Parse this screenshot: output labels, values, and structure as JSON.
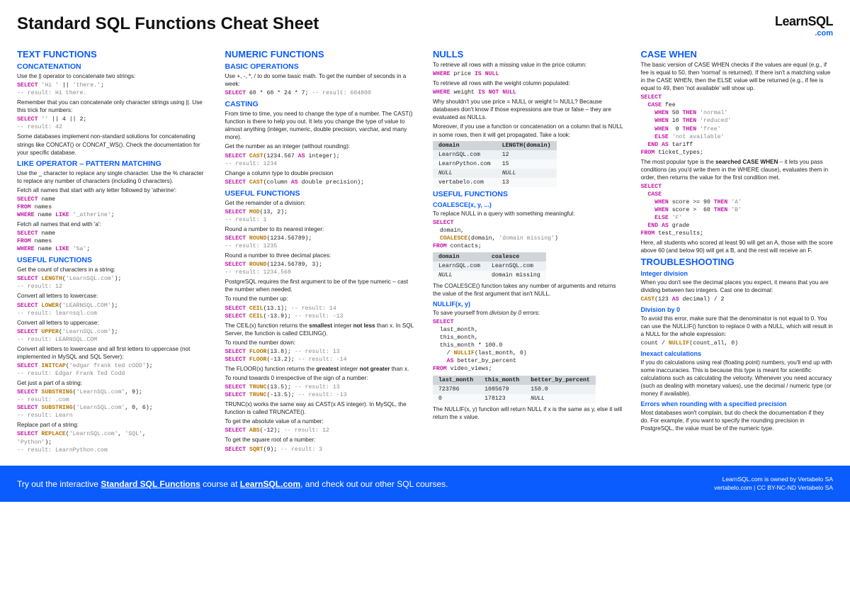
{
  "header": {
    "title": "Standard SQL Functions Cheat Sheet",
    "logo_top": "LearnSQL",
    "logo_bot": ".com"
  },
  "col1": {
    "h2": "TEXT FUNCTIONS",
    "s1": {
      "h3": "CONCATENATION",
      "p1": "Use the || operator to concatenate two strings:",
      "c1": "SELECT 'Hi ' || 'there.';\n-- result: Hi there.",
      "p2": "Remember that you can concatenate only character strings using ||. Use this trick for numbers:",
      "c2": "SELECT '' || 4 || 2;\n-- result: 42",
      "p3": "Some databases implement non-standard solutions for concatenating strings like CONCAT() or CONCAT_WS(). Check the documentation for your specific database."
    },
    "s2": {
      "h3": "LIKE OPERATOR – PATTERN MATCHING",
      "p1": "Use the _ character to replace any single character. Use the % character to replace any number of characters (including 0 characters).",
      "p2": "Fetch all names that start with any letter followed by 'atherine':",
      "c1": "SELECT name\nFROM names\nWHERE name LIKE '_atherine';",
      "p3": "Fetch all names that end with 'a':",
      "c2": "SELECT name\nFROM names\nWHERE name LIKE '%a';"
    },
    "s3": {
      "h3": "USEFUL FUNCTIONS",
      "p1": "Get the count of characters in a string:",
      "c1": "SELECT LENGTH('LearnSQL.com');\n-- result: 12",
      "p2": "Convert all letters to lowercase:",
      "c2": "SELECT LOWER('LEARNSQL.COM');\n-- result: learnsql.com",
      "p3": "Convert all letters to uppercase:",
      "c3": "SELECT UPPER('LearnSQL.com');\n-- result: LEARNSQL.COM",
      "p4": "Convert all letters to lowercase and all first letters to uppercase (not implemented in MySQL and SQL Server):",
      "c4": "SELECT INITCAP('edgar frank ted cODD');\n-- result: Edgar Frank Ted Codd",
      "p5": "Get just a part of a string:",
      "c5": "SELECT SUBSTRING('LearnSQL.com', 9);\n-- result: .com\nSELECT SUBSTRING('LearnSQL.com', 0, 6);\n-- result: Learn",
      "p6": "Replace part of a string:",
      "c6": "SELECT REPLACE('LearnSQL.com', 'SQL', 'Python');\n-- result: LearnPython.com"
    }
  },
  "col2": {
    "h2": "NUMERIC FUNCTIONS",
    "s1": {
      "h3": "BASIC OPERATIONS",
      "p1": "Use +, -, *, / to do some basic math. To get the number of seconds in a week:",
      "c1": "SELECT 60 * 60 * 24 * 7; -- result: 604800"
    },
    "s2": {
      "h3": "CASTING",
      "p1": "From time to time, you need to change the type of a number. The CAST() function is there to help you out. It lets you change the type of value to almost anything (integer, numeric, double precision, varchar, and many more).",
      "p2": "Get the number as an integer (without rounding):",
      "c1": "SELECT CAST(1234.567 AS integer);\n-- result: 1234",
      "p3": "Change a column type to double precision",
      "c2": "SELECT CAST(column AS double precision);"
    },
    "s3": {
      "h3": "USEFUL FUNCTIONS",
      "p1": "Get the remainder of a division:",
      "c1": "SELECT MOD(13, 2);\n-- result: 1",
      "p2": "Round a number to its nearest integer:",
      "c2": "SELECT ROUND(1234.56789);\n-- result: 1235",
      "p3": "Round a number to three decimal places:",
      "c3": "SELECT ROUND(1234.56789, 3);\n-- result: 1234.568",
      "p4": "PostgreSQL requires the first argument to be of the type numeric – cast the number when needed.",
      "p5": "To round the number up:",
      "c4": "SELECT CEIL(13.1); -- result: 14\nSELECT CEIL(-13.9); -- result: -13",
      "p6_a": "The CEIL(x) function returns the ",
      "p6_b": "smallest",
      "p6_c": " integer ",
      "p6_d": "not less",
      "p6_e": " than x. In SQL Server, the function is called CEILING().",
      "p7": "To round the number down:",
      "c5": "SELECT FLOOR(13.8); -- result: 13\nSELECT FLOOR(-13.2); -- result: -14",
      "p8_a": "The FLOOR(x) function returns the ",
      "p8_b": "greatest",
      "p8_c": " integer ",
      "p8_d": "not greater",
      "p8_e": " than x.",
      "p9": "To round towards 0 irrespective of the sign of a number:",
      "c6": "SELECT TRUNC(13.5); -- result: 13\nSELECT TRUNC(-13.5); -- result: -13",
      "p10": "TRUNC(x) works the same way as CAST(x AS integer). In MySQL, the function is called TRUNCATE().",
      "p11": "To get the absolute value of a number:",
      "c7": "SELECT ABS(-12); -- result: 12",
      "p12": "To get the square root of a number:",
      "c8": "SELECT SQRT(9); -- result: 3"
    }
  },
  "col3": {
    "h2": "NULLs",
    "s1": {
      "p1": "To retrieve all rows with a missing value in the price column:",
      "c1": "WHERE price IS NULL",
      "p2": "To retrieve all rows with the weight column populated:",
      "c2": "WHERE weight IS NOT NULL",
      "p3": "Why shouldn't you use price = NULL or weight != NULL? Because databases don't know if those expressions are true or false – they are evaluated as NULLs.",
      "p4": "Moreover, if you use a function or concatenation on a column that is NULL in some rows, then it will get propagated. Take a look:",
      "table": {
        "headers": [
          "domain",
          "LENGTH(domain)"
        ],
        "rows": [
          [
            "LearnSQL.com",
            "12"
          ],
          [
            "LearnPython.com",
            "15"
          ],
          [
            "NULL",
            "NULL"
          ],
          [
            "vertabelo.com",
            "13"
          ]
        ]
      }
    },
    "s2": {
      "h3": "USEFUL FUNCTIONS",
      "h4a": "COALESCE(x, y, ...)",
      "p1": "To replace NULL in a query with something meaningful:",
      "c1": "SELECT\n  domain,\n  COALESCE(domain, 'domain missing')\nFROM contacts;",
      "table": {
        "headers": [
          "domain",
          "coalesce"
        ],
        "rows": [
          [
            "LearnSQL.com",
            "LearnSQL.com"
          ],
          [
            "NULL",
            "domain missing"
          ]
        ]
      },
      "p2": "The COALESCE() function takes any number of arguments and returns the value of the first argument that isn't NULL.",
      "h4b": "NULLIF(x, y)",
      "p3_a": "To save yourself from ",
      "p3_b": "division by 0",
      "p3_c": " errors:",
      "c2": "SELECT\n  last_month,\n  this_month,\n  this_month * 100.0\n    / NULLIF(last_month, 0)\n    AS better_by_percent\nFROM video_views;",
      "table2": {
        "headers": [
          "last_month",
          "this_month",
          "better_by_percent"
        ],
        "rows": [
          [
            "723786",
            "1085679",
            "150.0"
          ],
          [
            "0",
            "178123",
            "NULL"
          ]
        ]
      },
      "p4": "The NULLIF(x, y) function will return NULL if x is the same as y, else it will return the x value."
    }
  },
  "col4": {
    "h2": "CASE WHEN",
    "s1": {
      "p1": "The basic version of CASE WHEN checks if the values are equal (e.g., if fee is equal to 50, then 'normal' is returned). If there isn't a matching value in the CASE WHEN, then the ELSE value will be returned (e.g., if fee is equal to 49, then 'not available' will show up.",
      "c1": "SELECT\n  CASE fee\n    WHEN 50 THEN 'normal'\n    WHEN 10 THEN 'reduced'\n    WHEN  0 THEN 'free'\n    ELSE 'not available'\n  END AS tariff\nFROM ticket_types;",
      "p2_a": "The most popular type is the ",
      "p2_b": "searched CASE WHEN",
      "p2_c": " – it lets you pass conditions (as you'd write them in the WHERE clause), evaluates them in order, then returns the value for the first condition met.",
      "c2": "SELECT\n  CASE\n    WHEN score >= 90 THEN 'A'\n    WHEN score >  60 THEN 'B'\n    ELSE 'F'\n  END AS grade\nFROM test_results;",
      "p3": "Here, all students who scored at least 90 will get an A, those with the score above 60 (and below 90) will get a B, and the rest will receive an F."
    },
    "h2b": "TROUBLESHOOTING",
    "s2": {
      "h4a": "Integer division",
      "p1": "When you don't see the decimal places you expect, it means that you are dividing between two integers. Cast one to decimal:",
      "c1": "CAST(123 AS decimal) / 2",
      "h4b": "Division by 0",
      "p2": "To avoid this error, make sure that the denominator is not equal to 0. You can use the NULLIF() function to replace 0 with a NULL, which will result in a NULL for the whole expression:",
      "c2": "count / NULLIF(count_all, 0)",
      "h4c": "Inexact calculations",
      "p3": "If you do calculations using real (floating point) numbers, you'll end up with some inaccuracies. This is because this type is meant for scientific calculations such as calculating the velocity. Whenever you need accuracy (such as dealing with monetary values), use the decimal / numeric type (or money if available).",
      "h4d": "Errors when rounding with a specified precision",
      "p4": "Most databases won't complain, but do check the documentation if they do. For example, if you want to specify the rounding precision in PostgreSQL, the value must be of the numeric type."
    }
  },
  "footer": {
    "left_a": "Try out the interactive ",
    "left_b": "Standard SQL Functions",
    "left_c": " course at ",
    "left_d": "LearnSQL.com",
    "left_e": ", and check out our other SQL courses.",
    "right_a": "LearnSQL.com is owned by Vertabelo SA",
    "right_b": "vertabelo.com | CC BY-NC-ND Vertabelo SA"
  }
}
